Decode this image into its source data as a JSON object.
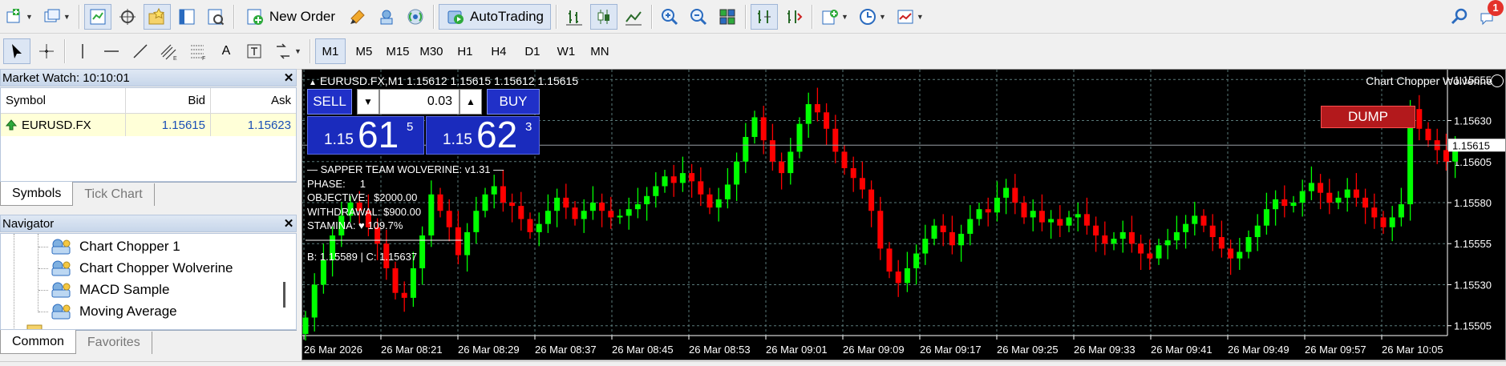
{
  "toolbar_main": {
    "new_order_label": "New Order",
    "autotrading_label": "AutoTrading",
    "notifications_count": "1"
  },
  "toolbar_draw": {
    "text_tool_label": "A",
    "timeframes": [
      "M1",
      "M5",
      "M15",
      "M30",
      "H1",
      "H4",
      "D1",
      "W1",
      "MN"
    ],
    "active_timeframe": "M1"
  },
  "market_watch": {
    "title": "Market Watch: 10:10:01",
    "columns": {
      "symbol": "Symbol",
      "bid": "Bid",
      "ask": "Ask"
    },
    "rows": [
      {
        "symbol": "EURUSD.FX",
        "bid": "1.15615",
        "ask": "1.15623"
      }
    ],
    "tabs": [
      "Symbols",
      "Tick Chart"
    ]
  },
  "navigator": {
    "title": "Navigator",
    "items": [
      "Chart Chopper 1",
      "Chart Chopper Wolverine",
      "MACD Sample",
      "Moving Average"
    ],
    "tabs": [
      "Common",
      "Favorites"
    ]
  },
  "chart": {
    "symbol_line": "EURUSD.FX,M1  1.15612 1.15615 1.15612 1.15615",
    "ea_name": "Chart Chopper Wolverine",
    "trade_panel": {
      "sell_label": "SELL",
      "buy_label": "BUY",
      "volume": "0.03",
      "sell_prefix": "1.15",
      "sell_big": "61",
      "sell_sup": "5",
      "buy_prefix": "1.15",
      "buy_big": "62",
      "buy_sup": "3"
    },
    "ea_panel": {
      "header": "— SAPPER TEAM WOLVERINE: v1.31 —",
      "phase": "PHASE:     1",
      "objective": "OBJECTIVE:  $2000.00",
      "withdrawal": "WITHDRAWAL: $900.00",
      "stamina": "STAMINA: ♥ 109.7%",
      "bc_line": "B: 1.15589 | C: 1.15637"
    },
    "dump_label": "DUMP",
    "current_price": "1.15615",
    "colors": {
      "bull": "#00ff00",
      "bear": "#ff0000",
      "background": "#000000",
      "grid": "#5a7a7a"
    }
  },
  "chart_data": {
    "type": "candlestick",
    "y_axis_labels": [
      "1.15655",
      "1.15630",
      "1.15605",
      "1.15580",
      "1.15555",
      "1.15530",
      "1.15505"
    ],
    "ylim": [
      1.15499,
      1.15661
    ],
    "x_axis_labels": [
      "26 Mar 2026",
      "26 Mar 08:21",
      "26 Mar 08:29",
      "26 Mar 08:37",
      "26 Mar 08:45",
      "26 Mar 08:53",
      "26 Mar 09:01",
      "26 Mar 09:09",
      "26 Mar 09:17",
      "26 Mar 09:25",
      "26 Mar 09:33",
      "26 Mar 09:41",
      "26 Mar 09:49",
      "26 Mar 09:57",
      "26 Mar 10:05"
    ],
    "closes": [
      1.1551,
      1.1553,
      1.15545,
      1.1556,
      1.15572,
      1.1558,
      1.15575,
      1.15565,
      1.15555,
      1.1554,
      1.15525,
      1.15522,
      1.1554,
      1.1556,
      1.15585,
      1.15575,
      1.15565,
      1.15548,
      1.15562,
      1.15575,
      1.15585,
      1.1559,
      1.1558,
      1.15578,
      1.1557,
      1.15562,
      1.15567,
      1.15575,
      1.15583,
      1.15577,
      1.1557,
      1.15575,
      1.1558,
      1.15575,
      1.15571,
      1.15572,
      1.15576,
      1.15579,
      1.15584,
      1.1559,
      1.15596,
      1.15592,
      1.15598,
      1.15593,
      1.15585,
      1.15577,
      1.15582,
      1.15591,
      1.15605,
      1.1562,
      1.15632,
      1.15618,
      1.15605,
      1.15598,
      1.15611,
      1.15628,
      1.1564,
      1.15635,
      1.15625,
      1.15611,
      1.15601,
      1.15595,
      1.15588,
      1.15575,
      1.15552,
      1.15538,
      1.15531,
      1.1554,
      1.15549,
      1.15558,
      1.15566,
      1.15562,
      1.15554,
      1.15561,
      1.1557,
      1.15576,
      1.15574,
      1.15583,
      1.15589,
      1.1558,
      1.15571,
      1.15575,
      1.15568,
      1.1557,
      1.15566,
      1.15571,
      1.15573,
      1.15566,
      1.1556,
      1.15555,
      1.15558,
      1.15562,
      1.15555,
      1.15549,
      1.15546,
      1.15554,
      1.15557,
      1.15562,
      1.15567,
      1.15572,
      1.15566,
      1.15559,
      1.15552,
      1.15546,
      1.1555,
      1.15559,
      1.15566,
      1.15576,
      1.15582,
      1.15578,
      1.1558,
      1.15587,
      1.15592,
      1.15586,
      1.1558,
      1.15583,
      1.15588,
      1.15583,
      1.15577,
      1.15571,
      1.15565,
      1.15571,
      1.15579,
      1.15637,
      1.15625,
      1.15618,
      1.15612,
      1.15605,
      1.15615
    ]
  }
}
